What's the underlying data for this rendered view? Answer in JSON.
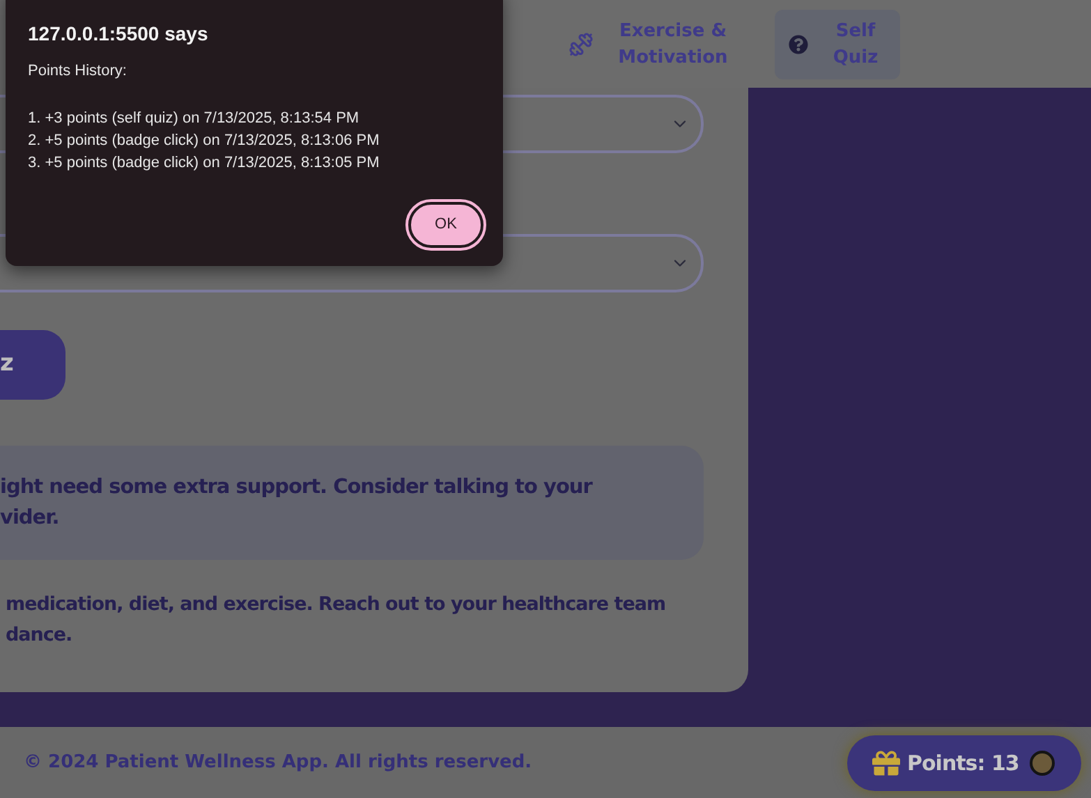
{
  "nav": [
    {
      "kind": "dumbbell",
      "label": "Exercise & Motivation",
      "selected": false
    },
    {
      "kind": "question",
      "label": "Self Quiz",
      "selected": true
    }
  ],
  "quiz_button": "z",
  "result_box": {
    "lines": [
      "ight need some extra support. Consider talking to your",
      "vider."
    ]
  },
  "advice": {
    "lines": [
      "medication, diet, and exercise. Reach out to your healthcare team",
      "dance."
    ]
  },
  "footer": "© 2024 Patient Wellness App. All rights reserved.",
  "points_badge": {
    "label": "Points: 13"
  },
  "dialog": {
    "title": "127.0.0.1:5500 says",
    "heading": "Points History:",
    "lines": [
      "1. +3 points (self quiz) on 7/13/2025, 8:13:54 PM",
      "2. +5 points (badge click) on 7/13/2025, 8:13:06 PM",
      "3. +5 points (badge click) on 7/13/2025, 8:13:05 PM"
    ],
    "button": "OK"
  }
}
